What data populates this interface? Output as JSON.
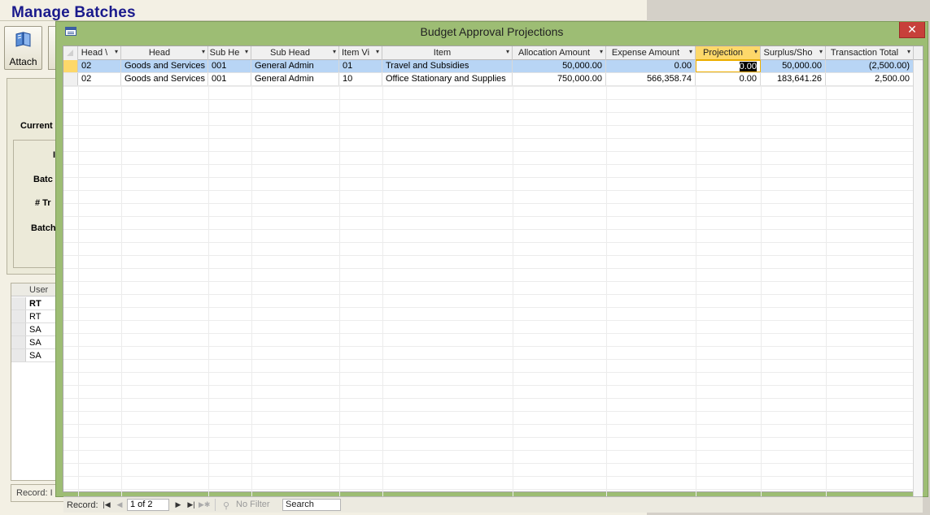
{
  "app": {
    "title": "Manage Batches",
    "attach_label": "Attach",
    "labels": [
      "Current",
      "I",
      "Batc",
      "# Tr",
      "Batch"
    ],
    "user_grid": {
      "header": "User",
      "rows": [
        "RT",
        "RT",
        "SA",
        "SA",
        "SA"
      ]
    },
    "status_text": "Record: I"
  },
  "popup": {
    "title": "Budget Approval Projections",
    "close_label": "✕",
    "columns": [
      "Head \\",
      "Head",
      "Sub He",
      "Sub Head",
      "Item Vi",
      "Item",
      "Allocation Amount",
      "Expense Amount",
      "Projection",
      "Surplus/Sho",
      "Transaction Total"
    ],
    "rows": [
      [
        "02",
        "Goods and Services",
        "001",
        "General Admin",
        "01",
        "Travel and Subsidies",
        "50,000.00",
        "0.00",
        "0.00",
        "50,000.00",
        "(2,500.00)"
      ],
      [
        "02",
        "Goods and Services",
        "001",
        "General Admin",
        "10",
        "Office Stationary and Supplies",
        "750,000.00",
        "566,358.74",
        "0.00",
        "183,641.26",
        "2,500.00"
      ]
    ],
    "nav": {
      "record_label": "Record:",
      "position": "1 of 2",
      "filter_label": "No Filter",
      "search_label": "Search"
    }
  }
}
